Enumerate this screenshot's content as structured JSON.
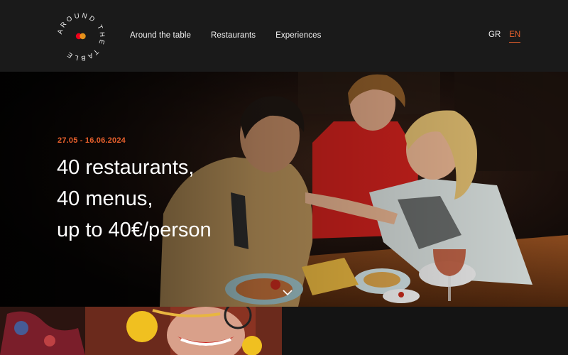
{
  "logo": {
    "ring_text": "AROUND THE TABLE",
    "mark_colors": [
      "#eb001b",
      "#f79e1b"
    ]
  },
  "nav": {
    "items": [
      {
        "label": "Around the table"
      },
      {
        "label": "Restaurants"
      },
      {
        "label": "Experiences"
      }
    ]
  },
  "language": {
    "options": [
      {
        "label": "GR",
        "active": false
      },
      {
        "label": "EN",
        "active": true
      }
    ]
  },
  "hero": {
    "date_range": "27.05 - 16.06.2024",
    "title_lines": [
      "40 restaurants,",
      "40 menus,",
      "up to 40€/person"
    ]
  },
  "icons": {
    "scroll": "chevron-down-icon"
  },
  "colors": {
    "accent": "#e8602c",
    "header_bg": "#1a1a1a",
    "page_bg": "#121212"
  }
}
